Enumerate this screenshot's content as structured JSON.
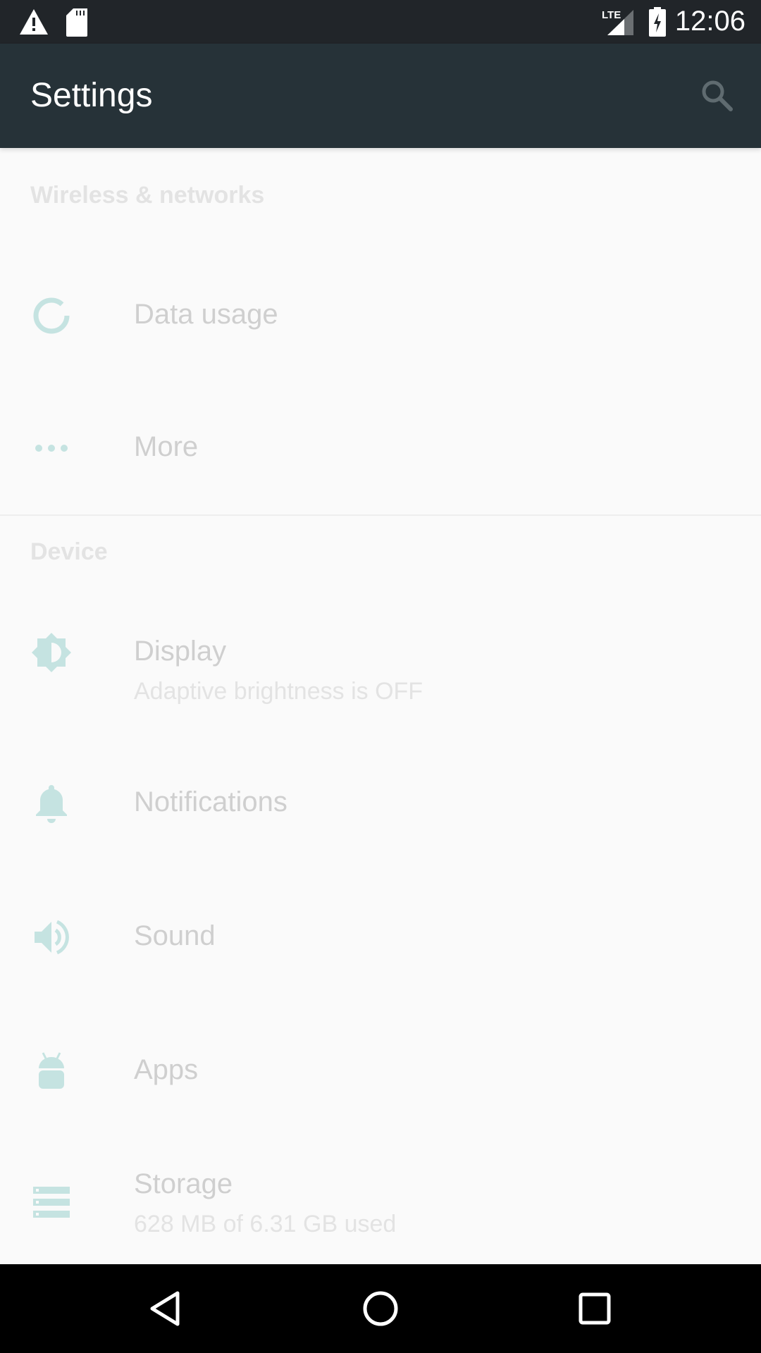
{
  "status_bar": {
    "time": "12:06",
    "icons": [
      "warning-icon",
      "sd-card-icon",
      "lte-signal-icon",
      "battery-charging-icon"
    ]
  },
  "toolbar": {
    "title": "Settings",
    "search_icon": "search-icon"
  },
  "sections": [
    {
      "header": "Wireless & networks",
      "items": [
        {
          "title": "Data usage",
          "icon": "data-usage-icon"
        },
        {
          "title": "More",
          "icon": "more-dots-icon"
        }
      ]
    },
    {
      "header": "Device",
      "items": [
        {
          "title": "Display",
          "subtitle": "Adaptive brightness is OFF",
          "icon": "brightness-icon"
        },
        {
          "title": "Notifications",
          "icon": "bell-icon"
        },
        {
          "title": "Sound",
          "icon": "volume-icon"
        },
        {
          "title": "Apps",
          "icon": "android-icon"
        },
        {
          "title": "Storage",
          "subtitle": "628 MB of 6.31 GB used",
          "icon": "storage-icon"
        }
      ]
    }
  ],
  "colors": {
    "toolbar": "#263238",
    "status_bar": "#212529",
    "icon_tint": "#c5e3e1",
    "background": "#fafafa"
  }
}
